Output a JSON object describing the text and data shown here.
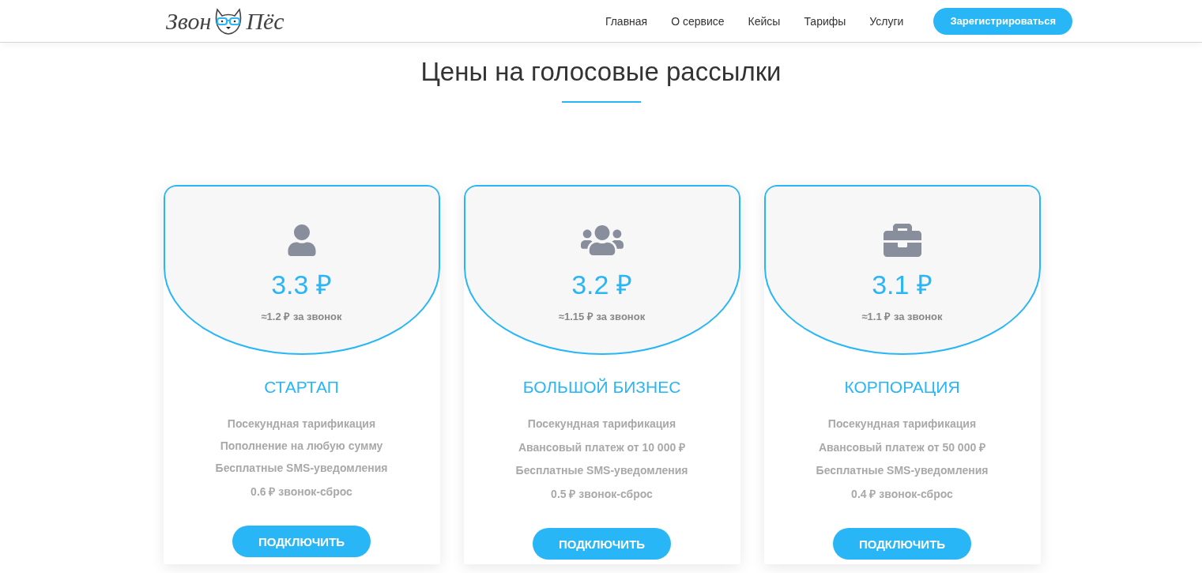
{
  "header": {
    "logo": {
      "left": "Звон",
      "right": "Пёс"
    },
    "nav": [
      {
        "label": "Главная"
      },
      {
        "label": "О сервисе"
      },
      {
        "label": "Кейсы"
      },
      {
        "label": "Тарифы"
      },
      {
        "label": "Услуги"
      }
    ],
    "cta": "Зарегистрироваться"
  },
  "section": {
    "title": "Цены на голосовые рассылки"
  },
  "plans": [
    {
      "price": "3.3 ₽",
      "per_call": "≈1.2 ₽ за звонок",
      "name": "СТАРТАП",
      "features": [
        "Посекундная тарификация",
        "Пополнение на любую сумму",
        "Бесплатные SMS-уведомления",
        "0.6 ₽ звонок-сброс"
      ],
      "button": "ПОДКЛЮЧИТЬ"
    },
    {
      "price": "3.2 ₽",
      "per_call": "≈1.15 ₽ за звонок",
      "name": "БОЛЬШОЙ БИЗНЕС",
      "features": [
        "Посекундная тарификация",
        "Авансовый платеж от 10 000 ₽",
        "Бесплатные SMS-уведомления",
        "0.5 ₽ звонок-сброс"
      ],
      "button": "ПОДКЛЮЧИТЬ"
    },
    {
      "price": "3.1 ₽",
      "per_call": "≈1.1 ₽ за звонок",
      "name": "КОРПОРАЦИЯ",
      "features": [
        "Посекундная тарификация",
        "Авансовый платеж от 50 000 ₽",
        "Бесплатные SMS-уведомления",
        "0.4 ₽ звонок-сброс"
      ],
      "button": "ПОДКЛЮЧИТЬ"
    }
  ]
}
